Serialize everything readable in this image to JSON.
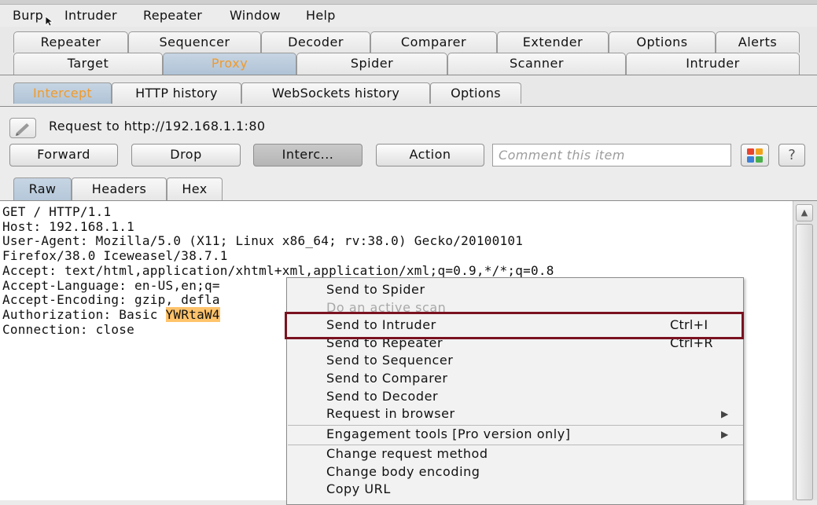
{
  "menubar": {
    "items": [
      "Burp",
      "Intruder",
      "Repeater",
      "Window",
      "Help"
    ]
  },
  "main_tabs": {
    "row1": [
      "Repeater",
      "Sequencer",
      "Decoder",
      "Comparer",
      "Extender",
      "Options",
      "Alerts"
    ],
    "row2": [
      "Target",
      "Proxy",
      "Spider",
      "Scanner",
      "Intruder"
    ],
    "active": "Proxy"
  },
  "proxy_tabs": {
    "items": [
      "Intercept",
      "HTTP history",
      "WebSockets history",
      "Options"
    ],
    "active": "Intercept"
  },
  "intercept": {
    "request_label": "Request to http://192.168.1.1:80",
    "buttons": {
      "forward": "Forward",
      "drop": "Drop",
      "intercept": "Interc...",
      "action": "Action"
    },
    "comment_placeholder": "Comment this item",
    "help": "?"
  },
  "message_tabs": {
    "items": [
      "Raw",
      "Headers",
      "Hex"
    ],
    "active": "Raw"
  },
  "request": {
    "lines": [
      "GET / HTTP/1.1",
      "Host: 192.168.1.1",
      "User-Agent: Mozilla/5.0 (X11; Linux x86_64; rv:38.0) Gecko/20100101",
      "Firefox/38.0 Iceweasel/38.7.1",
      "Accept: text/html,application/xhtml+xml,application/xml;q=0.9,*/*;q=0.8",
      "Accept-Language: en-US,en;q=",
      "Accept-Encoding: gzip, defla",
      "Authorization: Basic ",
      "Connection: close"
    ],
    "auth_token_visible": "YWRtaW4"
  },
  "context_menu": {
    "items": [
      {
        "label": "Send to Spider",
        "shortcut": "",
        "submenu": false,
        "disabled": false
      },
      {
        "label": "Do an active scan",
        "shortcut": "",
        "submenu": false,
        "disabled": true
      },
      {
        "label": "Send to Intruder",
        "shortcut": "Ctrl+I",
        "submenu": false,
        "disabled": false
      },
      {
        "label": "Send to Repeater",
        "shortcut": "Ctrl+R",
        "submenu": false,
        "disabled": false
      },
      {
        "label": "Send to Sequencer",
        "shortcut": "",
        "submenu": false,
        "disabled": false
      },
      {
        "label": "Send to Comparer",
        "shortcut": "",
        "submenu": false,
        "disabled": false
      },
      {
        "label": "Send to Decoder",
        "shortcut": "",
        "submenu": false,
        "disabled": false
      },
      {
        "label": "Request in browser",
        "shortcut": "",
        "submenu": true,
        "disabled": false
      },
      {
        "label": "Engagement tools [Pro version only]",
        "shortcut": "",
        "submenu": true,
        "disabled": false
      },
      {
        "label": "Change request method",
        "shortcut": "",
        "submenu": false,
        "disabled": false
      },
      {
        "label": "Change body encoding",
        "shortcut": "",
        "submenu": false,
        "disabled": false
      },
      {
        "label": "Copy URL",
        "shortcut": "",
        "submenu": false,
        "disabled": false
      }
    ],
    "highlighted_item": "Send to Intruder",
    "highlight_color": "#7a1220"
  },
  "colors": {
    "active_tab_text": "#f19a2a",
    "active_tab_bg": "#b9cbdc",
    "token_highlight": "#ffc36b"
  }
}
